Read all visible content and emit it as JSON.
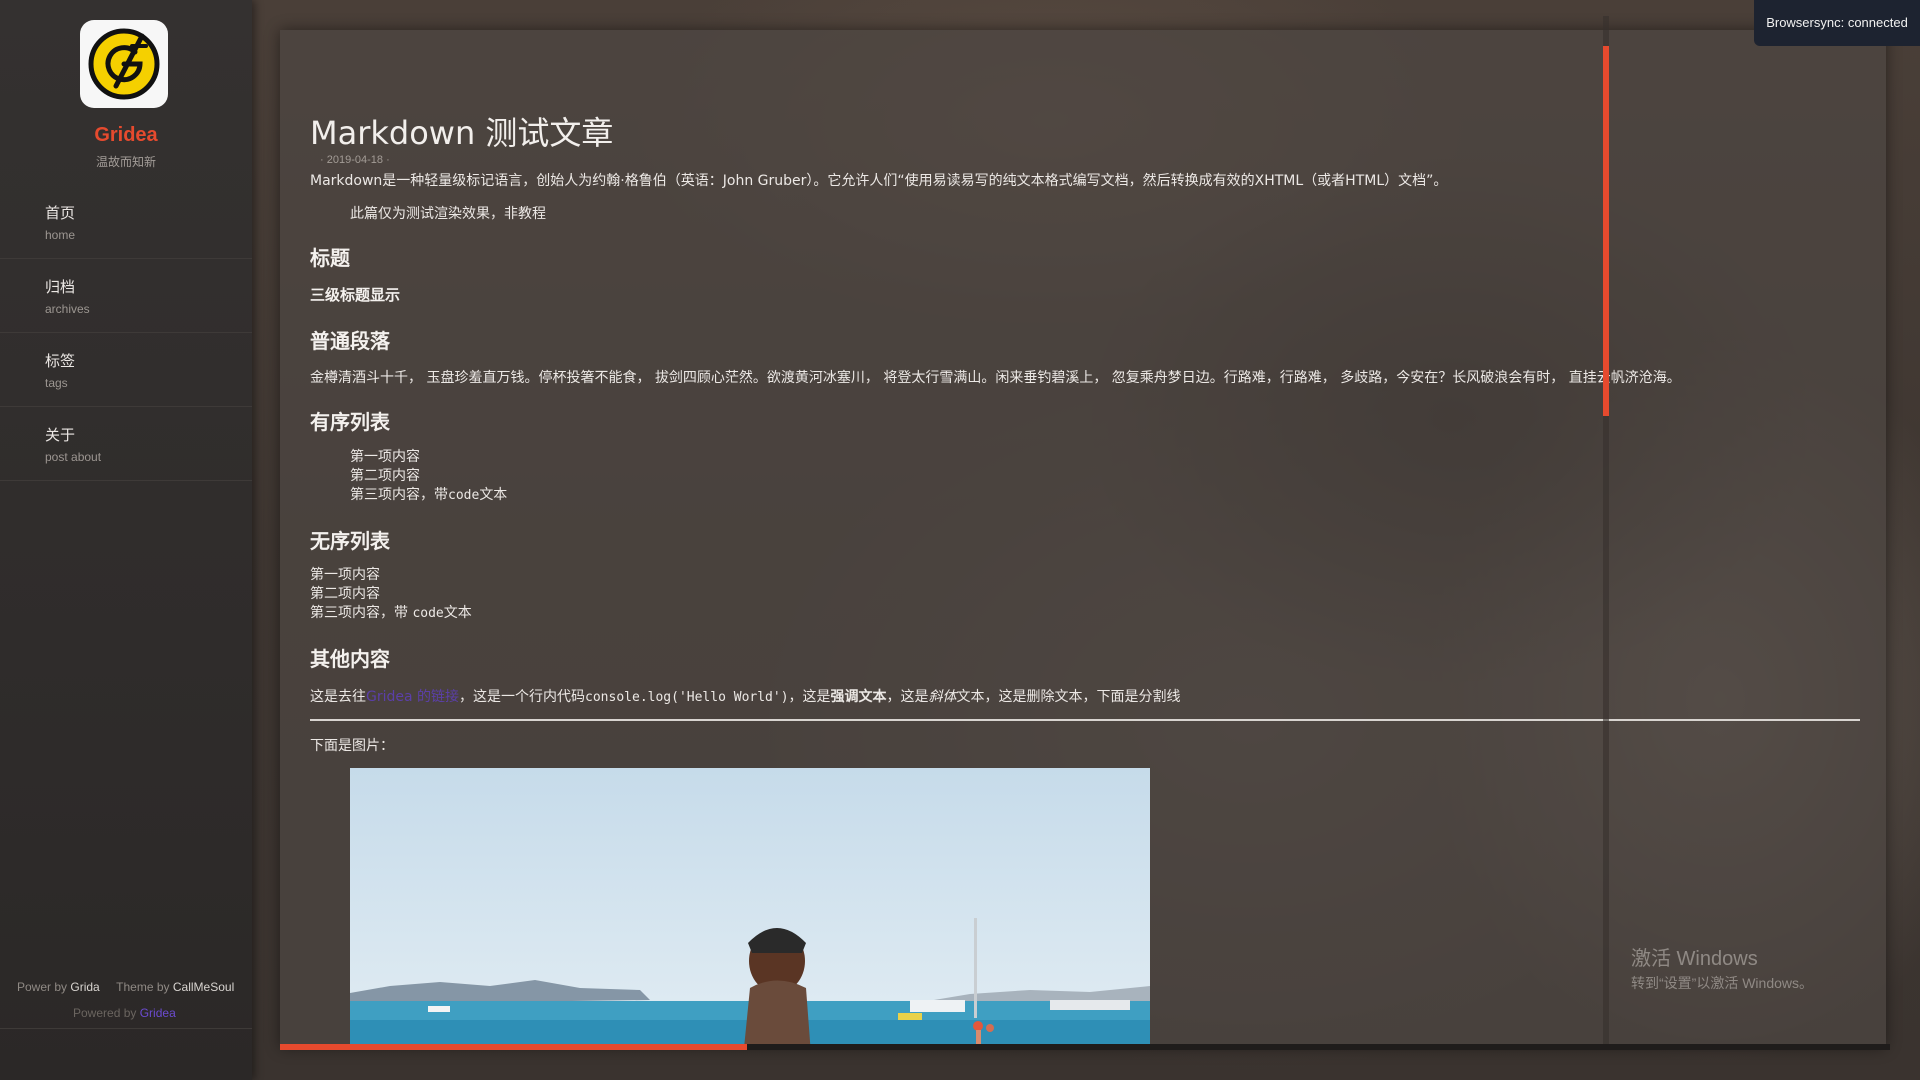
{
  "sidebar": {
    "site_name": "Gridea",
    "site_desc": "温故而知新",
    "nav": [
      {
        "zh": "首页",
        "en": "home"
      },
      {
        "zh": "归档",
        "en": "archives"
      },
      {
        "zh": "标签",
        "en": "tags"
      },
      {
        "zh": "关于",
        "en": "post about"
      }
    ],
    "footer": {
      "power_label": "Power by",
      "power_link": "Grida",
      "theme_label": "Theme by",
      "theme_link": "CallMeSoul",
      "powered_label": "Powered by",
      "powered_link": "Gridea"
    }
  },
  "post": {
    "title": "Markdown 测试文章",
    "date": "2019-04-18",
    "intro": "Markdown是一种轻量级标记语言，创始人为约翰·格鲁伯（英语：John Gruber）。它允许人们“使用易读易写的纯文本格式编写文档，然后转换成有效的XHTML（或者HTML）文档”。",
    "quote": "此篇仅为测试渲染效果，非教程",
    "h_title": "标题",
    "h3_demo": "三级标题显示",
    "h_paragraph": "普通段落",
    "paragraph": "金樽清酒斗十千， 玉盘珍羞直万钱。停杯投箸不能食， 拔剑四顾心茫然。欲渡黄河冰塞川， 将登太行雪满山。闲来垂钓碧溪上， 忽复乘舟梦日边。行路难，行路难， 多歧路，今安在？长风破浪会有时， 直挂云帆济沧海。",
    "h_ordered": "有序列表",
    "ordered": [
      "第一项内容",
      "第二项内容"
    ],
    "ordered_third_prefix": "第三项内容，带",
    "ordered_third_code": "code",
    "ordered_third_suffix": "文本",
    "h_unordered": "无序列表",
    "unordered": [
      "第一项内容",
      "第二项内容"
    ],
    "unordered_third_prefix": "第三项内容，带 ",
    "unordered_third_code": "code",
    "unordered_third_suffix": "文本",
    "h_other": "其他内容",
    "other": {
      "t1": "这是去往",
      "link": "Gridea 的链接",
      "t2": "，这是一个行内代码",
      "code": "console.log('Hello World')",
      "t3": "，这是",
      "strong": "强调文本",
      "t4": "，这是",
      "em": "斜体",
      "t5": "文本，这是删除文本，下面是分割线"
    },
    "image_caption": "下面是图片："
  },
  "reading_progress": 0.29,
  "scroll_position": 0.28,
  "browsersync": "Browsersync: connected",
  "windows_watermark": {
    "line1": "激活 Windows",
    "line2": "转到“设置”以激活 Windows。"
  },
  "colors": {
    "accent": "#e64a2e",
    "link": "#5b3fa8",
    "logo_yellow": "#f5d000"
  }
}
